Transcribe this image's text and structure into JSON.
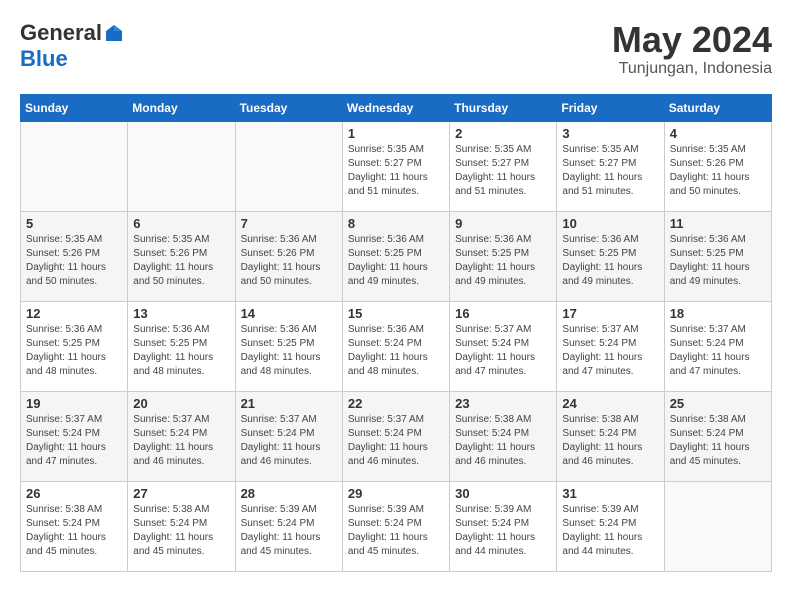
{
  "header": {
    "logo_general": "General",
    "logo_blue": "Blue",
    "month_year": "May 2024",
    "location": "Tunjungan, Indonesia"
  },
  "weekdays": [
    "Sunday",
    "Monday",
    "Tuesday",
    "Wednesday",
    "Thursday",
    "Friday",
    "Saturday"
  ],
  "weeks": [
    [
      {
        "day": "",
        "info": ""
      },
      {
        "day": "",
        "info": ""
      },
      {
        "day": "",
        "info": ""
      },
      {
        "day": "1",
        "info": "Sunrise: 5:35 AM\nSunset: 5:27 PM\nDaylight: 11 hours\nand 51 minutes."
      },
      {
        "day": "2",
        "info": "Sunrise: 5:35 AM\nSunset: 5:27 PM\nDaylight: 11 hours\nand 51 minutes."
      },
      {
        "day": "3",
        "info": "Sunrise: 5:35 AM\nSunset: 5:27 PM\nDaylight: 11 hours\nand 51 minutes."
      },
      {
        "day": "4",
        "info": "Sunrise: 5:35 AM\nSunset: 5:26 PM\nDaylight: 11 hours\nand 50 minutes."
      }
    ],
    [
      {
        "day": "5",
        "info": "Sunrise: 5:35 AM\nSunset: 5:26 PM\nDaylight: 11 hours\nand 50 minutes."
      },
      {
        "day": "6",
        "info": "Sunrise: 5:35 AM\nSunset: 5:26 PM\nDaylight: 11 hours\nand 50 minutes."
      },
      {
        "day": "7",
        "info": "Sunrise: 5:36 AM\nSunset: 5:26 PM\nDaylight: 11 hours\nand 50 minutes."
      },
      {
        "day": "8",
        "info": "Sunrise: 5:36 AM\nSunset: 5:25 PM\nDaylight: 11 hours\nand 49 minutes."
      },
      {
        "day": "9",
        "info": "Sunrise: 5:36 AM\nSunset: 5:25 PM\nDaylight: 11 hours\nand 49 minutes."
      },
      {
        "day": "10",
        "info": "Sunrise: 5:36 AM\nSunset: 5:25 PM\nDaylight: 11 hours\nand 49 minutes."
      },
      {
        "day": "11",
        "info": "Sunrise: 5:36 AM\nSunset: 5:25 PM\nDaylight: 11 hours\nand 49 minutes."
      }
    ],
    [
      {
        "day": "12",
        "info": "Sunrise: 5:36 AM\nSunset: 5:25 PM\nDaylight: 11 hours\nand 48 minutes."
      },
      {
        "day": "13",
        "info": "Sunrise: 5:36 AM\nSunset: 5:25 PM\nDaylight: 11 hours\nand 48 minutes."
      },
      {
        "day": "14",
        "info": "Sunrise: 5:36 AM\nSunset: 5:25 PM\nDaylight: 11 hours\nand 48 minutes."
      },
      {
        "day": "15",
        "info": "Sunrise: 5:36 AM\nSunset: 5:24 PM\nDaylight: 11 hours\nand 48 minutes."
      },
      {
        "day": "16",
        "info": "Sunrise: 5:37 AM\nSunset: 5:24 PM\nDaylight: 11 hours\nand 47 minutes."
      },
      {
        "day": "17",
        "info": "Sunrise: 5:37 AM\nSunset: 5:24 PM\nDaylight: 11 hours\nand 47 minutes."
      },
      {
        "day": "18",
        "info": "Sunrise: 5:37 AM\nSunset: 5:24 PM\nDaylight: 11 hours\nand 47 minutes."
      }
    ],
    [
      {
        "day": "19",
        "info": "Sunrise: 5:37 AM\nSunset: 5:24 PM\nDaylight: 11 hours\nand 47 minutes."
      },
      {
        "day": "20",
        "info": "Sunrise: 5:37 AM\nSunset: 5:24 PM\nDaylight: 11 hours\nand 46 minutes."
      },
      {
        "day": "21",
        "info": "Sunrise: 5:37 AM\nSunset: 5:24 PM\nDaylight: 11 hours\nand 46 minutes."
      },
      {
        "day": "22",
        "info": "Sunrise: 5:37 AM\nSunset: 5:24 PM\nDaylight: 11 hours\nand 46 minutes."
      },
      {
        "day": "23",
        "info": "Sunrise: 5:38 AM\nSunset: 5:24 PM\nDaylight: 11 hours\nand 46 minutes."
      },
      {
        "day": "24",
        "info": "Sunrise: 5:38 AM\nSunset: 5:24 PM\nDaylight: 11 hours\nand 46 minutes."
      },
      {
        "day": "25",
        "info": "Sunrise: 5:38 AM\nSunset: 5:24 PM\nDaylight: 11 hours\nand 45 minutes."
      }
    ],
    [
      {
        "day": "26",
        "info": "Sunrise: 5:38 AM\nSunset: 5:24 PM\nDaylight: 11 hours\nand 45 minutes."
      },
      {
        "day": "27",
        "info": "Sunrise: 5:38 AM\nSunset: 5:24 PM\nDaylight: 11 hours\nand 45 minutes."
      },
      {
        "day": "28",
        "info": "Sunrise: 5:39 AM\nSunset: 5:24 PM\nDaylight: 11 hours\nand 45 minutes."
      },
      {
        "day": "29",
        "info": "Sunrise: 5:39 AM\nSunset: 5:24 PM\nDaylight: 11 hours\nand 45 minutes."
      },
      {
        "day": "30",
        "info": "Sunrise: 5:39 AM\nSunset: 5:24 PM\nDaylight: 11 hours\nand 44 minutes."
      },
      {
        "day": "31",
        "info": "Sunrise: 5:39 AM\nSunset: 5:24 PM\nDaylight: 11 hours\nand 44 minutes."
      },
      {
        "day": "",
        "info": ""
      }
    ]
  ]
}
